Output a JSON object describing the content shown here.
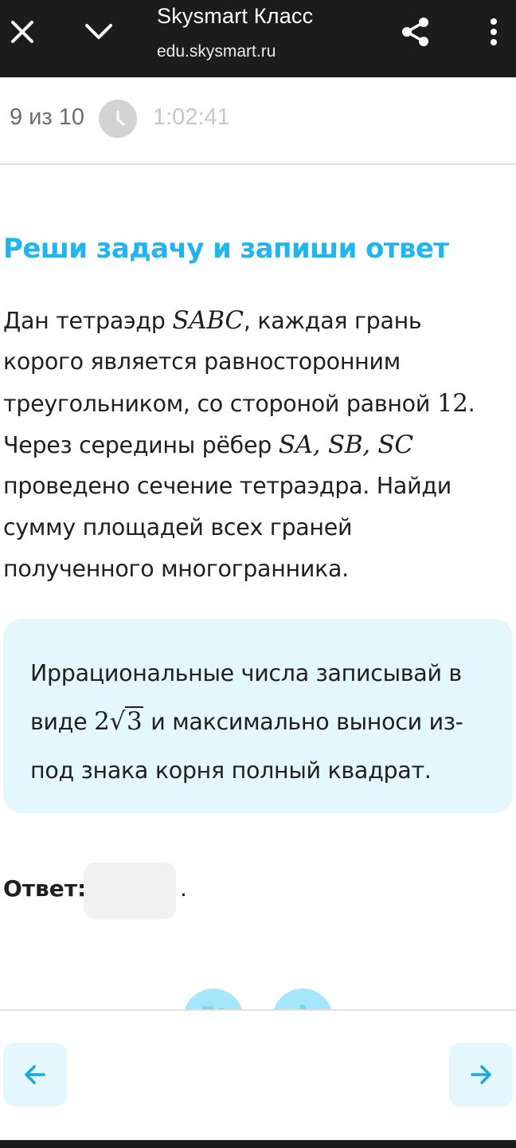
{
  "browser": {
    "title": "Skysmart Класс",
    "url": "edu.skysmart.ru",
    "icons": {
      "close": "close-icon",
      "collapse": "chevron-down-icon",
      "share": "share-icon",
      "more": "more-vertical-icon"
    }
  },
  "progress": {
    "counter": "9 из 10",
    "timer": "1:02:41",
    "icon": "clock-icon"
  },
  "task": {
    "heading": "Реши задачу и запиши ответ",
    "lines": [
      {
        "before": "Дан тетраэдр ",
        "math": "SABC",
        "after": ", каждая грань"
      },
      {
        "before": "корого является равносторонним",
        "math": "",
        "after": ""
      },
      {
        "before": "треугольником, со стороной равной ",
        "math_plain": "12",
        "after": "."
      },
      {
        "before": "Через середины рёбер ",
        "math": "SA, SB, SC",
        "after": ""
      },
      {
        "before": "проведено сечение тетраэдра. Найди",
        "math": "",
        "after": ""
      },
      {
        "before": "сумму площадей всех граней",
        "math": "",
        "after": ""
      },
      {
        "before": "полученного многогранника.",
        "math": "",
        "after": ""
      }
    ]
  },
  "hint": {
    "line1": "Иррациональные числа записывай в",
    "line2_before": "виде ",
    "line2_coef": "2",
    "line2_radicand": "3",
    "line2_after": " и максимально выноси из-",
    "line3": "под знака корня полный квадрат."
  },
  "answer": {
    "label": "Ответ:",
    "value": "",
    "placeholder": "",
    "dot": "."
  },
  "navigation": {
    "prev_icon": "arrow-left-icon",
    "next_icon": "arrow-right-icon"
  },
  "colors": {
    "accent": "#22b4f0",
    "hint_bg": "#e3f7fc",
    "topbar_bg": "#1c1c1c",
    "nav_arrow": "#1aa6de"
  }
}
